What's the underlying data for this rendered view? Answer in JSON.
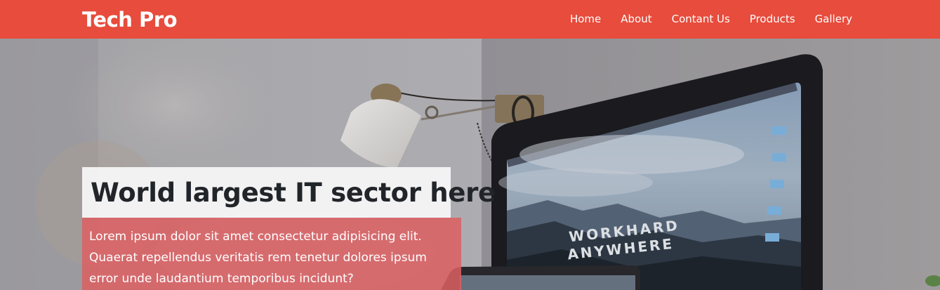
{
  "navbar": {
    "brand": "Tech Pro",
    "links": [
      "Home",
      "About",
      "Contant Us",
      "Products",
      "Gallery"
    ],
    "color": "#e74c3c"
  },
  "hero": {
    "title": "World largest IT sector here",
    "text": "Lorem ipsum dolor sit amet consectetur adipisicing elit. Quaerat repellendus veritatis rem tenetur dolores ipsum error unde laudantium temporibus incidunt?",
    "screen_text_1": "WORKHARD",
    "screen_text_2": "ANYWHERE",
    "text_box_color": "#dc6062"
  }
}
